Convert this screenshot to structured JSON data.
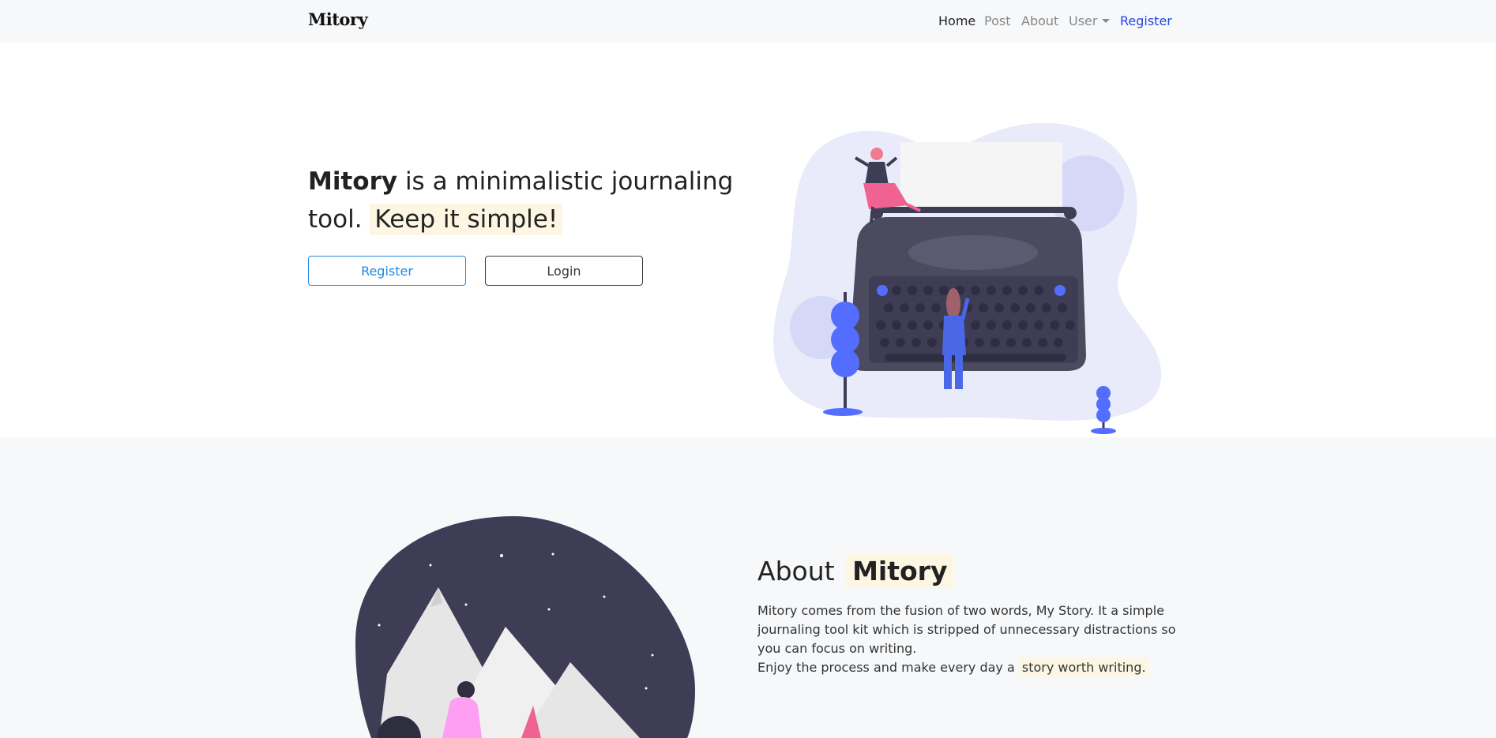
{
  "nav": {
    "brand": "Mitory",
    "links": [
      "Home",
      "Post",
      "About",
      "User",
      "Register"
    ]
  },
  "hero": {
    "brand_word": "Mitory",
    "text_rest": " is a minimalistic journaling tool.",
    "highlight": "Keep it simple!",
    "register_label": "Register",
    "login_label": "Login"
  },
  "about": {
    "heading_prefix": "About",
    "heading_highlight": "Mitory",
    "paragraph1": "Mitory comes from the fusion of two words, My Story. It a simple journaling tool kit which is stripped of unnecessary distractions so you can focus on writing.",
    "paragraph2_prefix": "Enjoy the process and make every day a",
    "paragraph2_highlight": "story worth writing."
  },
  "colors": {
    "accent_blue": "#1e88e5",
    "highlight_bg": "#fdf6e3",
    "navbar_bg": "#f7f8fa",
    "register_link": "#2346e0"
  },
  "icons": [
    "dropdown-caret-icon"
  ]
}
